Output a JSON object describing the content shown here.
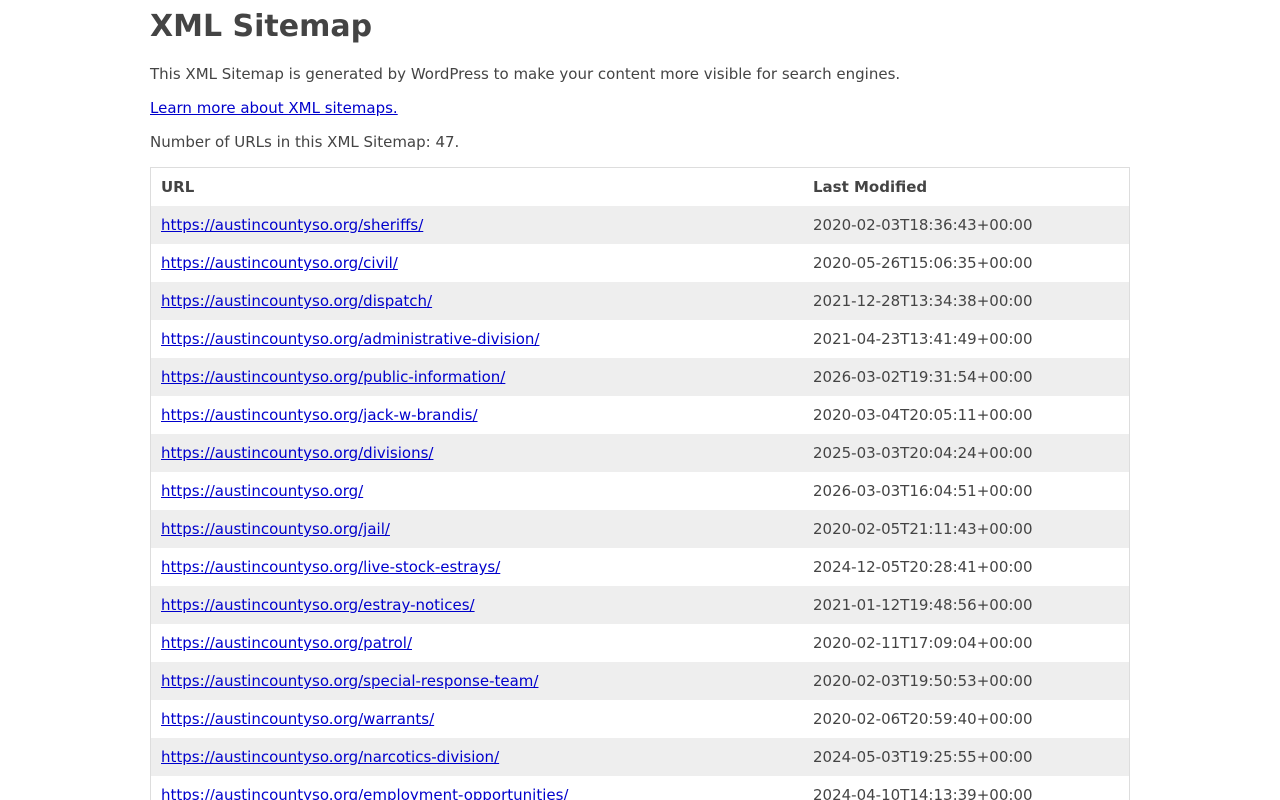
{
  "header": {
    "title": "XML Sitemap",
    "description": "This XML Sitemap is generated by WordPress to make your content more visible for search engines.",
    "learn_more_link": "Learn more about XML sitemaps.",
    "url_count": "Number of URLs in this XML Sitemap: 47."
  },
  "table": {
    "columns": [
      "URL",
      "Last Modified"
    ],
    "rows": [
      {
        "url": "https://austincountyso.org/sheriffs/",
        "modified": "2020-02-03T18:36:43+00:00"
      },
      {
        "url": "https://austincountyso.org/civil/",
        "modified": "2020-05-26T15:06:35+00:00"
      },
      {
        "url": "https://austincountyso.org/dispatch/",
        "modified": "2021-12-28T13:34:38+00:00"
      },
      {
        "url": "https://austincountyso.org/administrative-division/",
        "modified": "2021-04-23T13:41:49+00:00"
      },
      {
        "url": "https://austincountyso.org/public-information/",
        "modified": "2026-03-02T19:31:54+00:00"
      },
      {
        "url": "https://austincountyso.org/jack-w-brandis/",
        "modified": "2020-03-04T20:05:11+00:00"
      },
      {
        "url": "https://austincountyso.org/divisions/",
        "modified": "2025-03-03T20:04:24+00:00"
      },
      {
        "url": "https://austincountyso.org/",
        "modified": "2026-03-03T16:04:51+00:00"
      },
      {
        "url": "https://austincountyso.org/jail/",
        "modified": "2020-02-05T21:11:43+00:00"
      },
      {
        "url": "https://austincountyso.org/live-stock-estrays/",
        "modified": "2024-12-05T20:28:41+00:00"
      },
      {
        "url": "https://austincountyso.org/estray-notices/",
        "modified": "2021-01-12T19:48:56+00:00"
      },
      {
        "url": "https://austincountyso.org/patrol/",
        "modified": "2020-02-11T17:09:04+00:00"
      },
      {
        "url": "https://austincountyso.org/special-response-team/",
        "modified": "2020-02-03T19:50:53+00:00"
      },
      {
        "url": "https://austincountyso.org/warrants/",
        "modified": "2020-02-06T20:59:40+00:00"
      },
      {
        "url": "https://austincountyso.org/narcotics-division/",
        "modified": "2024-05-03T19:25:55+00:00"
      },
      {
        "url": "https://austincountyso.org/employment-opportunities/",
        "modified": "2024-04-10T14:13:39+00:00"
      }
    ]
  },
  "colors": {
    "text": "#444444",
    "link": "#0000cc",
    "stripe": "#eeeeee",
    "border": "#dddddd"
  }
}
